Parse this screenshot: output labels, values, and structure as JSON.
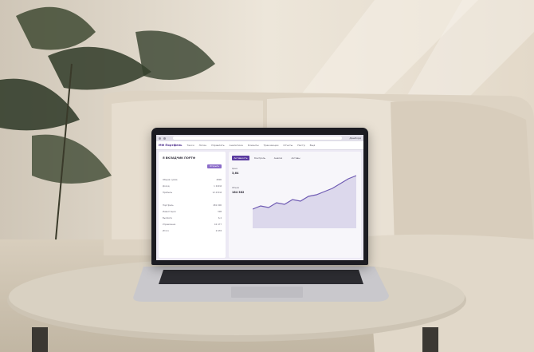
{
  "laptop": {
    "browser": {
      "tab_title": "Дашборд"
    },
    "app": {
      "brand": "МФ Портфель",
      "nav": [
        "Такси",
        "Логин",
        "Управлять",
        "Аналитика",
        "Клиенты",
        "Транзакции",
        "Отчеты",
        "Настр",
        "Ещё"
      ]
    },
    "left_panel": {
      "title": "Я ВКЛАДЧИК ПОРТФ",
      "button_label": "Открыть",
      "stats": [
        {
          "label": "Общая сумма",
          "value": "4800"
        },
        {
          "label": "Доход",
          "value": "1 249 ₽"
        },
        {
          "label": "Прибыль",
          "value": "12 430 ₽"
        },
        {
          "label": "Портфель",
          "value": "481 000"
        },
        {
          "label": "Инвестиции",
          "value": "308"
        },
        {
          "label": "Выплата",
          "value": "6,4"
        },
        {
          "label": "Управление",
          "value": "42 477"
        },
        {
          "label": "Итого",
          "value": "2 678"
        }
      ]
    },
    "right_panel": {
      "tabs": [
        "Активность",
        "Контроль",
        "Анализ",
        "Активы"
      ],
      "active_tab_index": 0,
      "metric_label": "Цена",
      "metric_value": "3,64",
      "metric2_label": "Объем",
      "metric2_value": "184 382"
    }
  }
}
